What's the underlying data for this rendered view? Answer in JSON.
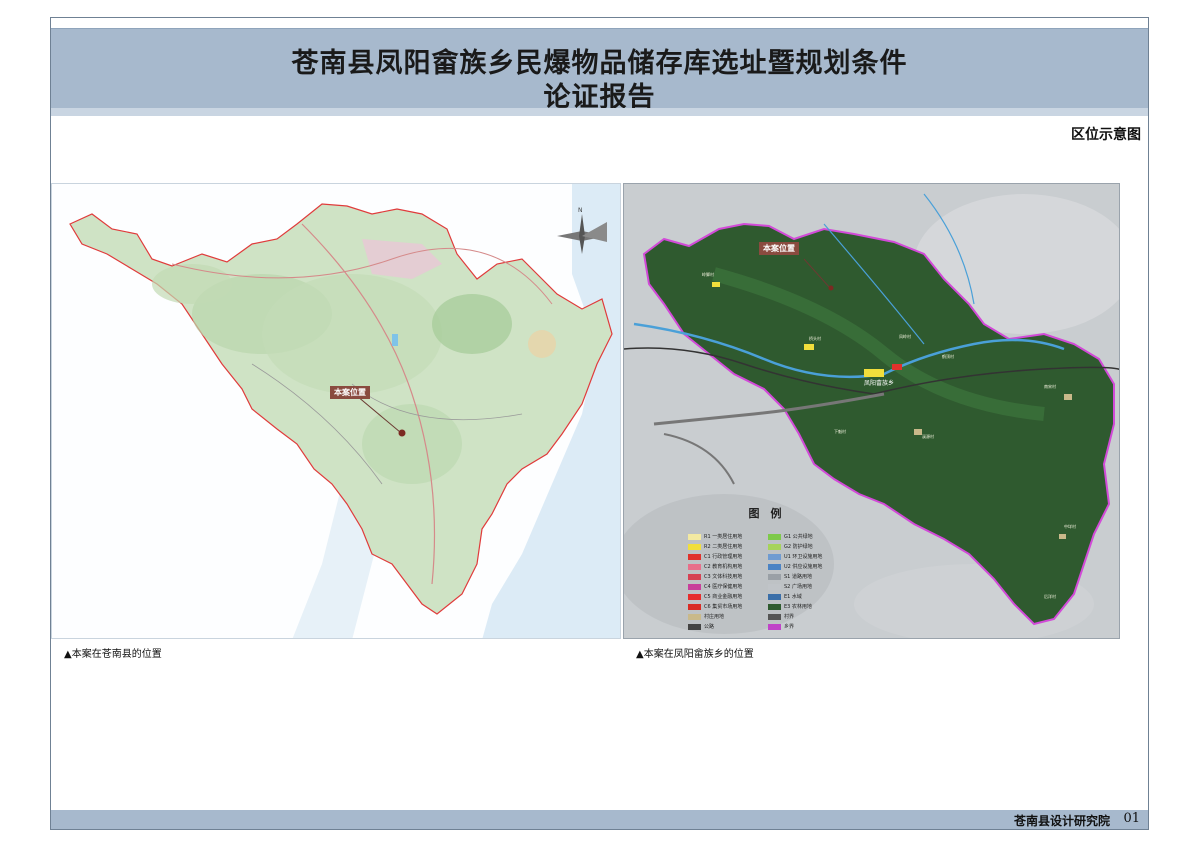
{
  "header": {
    "title_line1": "苍南县凤阳畲族乡民爆物品储存库选址暨规划条件",
    "title_line2": "论证报告"
  },
  "section_label": "区位示意图",
  "left_map": {
    "marker_label": "本案位置",
    "caption": "▲本案在苍南县的位置"
  },
  "right_map": {
    "marker_label": "本案位置",
    "caption": "▲本案在凤阳畲族乡的位置",
    "town_label": "凤阳畲族乡",
    "legend": {
      "title": "图　例",
      "items_left": [
        {
          "code": "R1",
          "label": "一类居住用地",
          "color": "#f3e9a2"
        },
        {
          "code": "R2",
          "label": "二类居住用地",
          "color": "#f1de3c"
        },
        {
          "code": "C1",
          "label": "行政管理用地",
          "color": "#e0312c"
        },
        {
          "code": "C2",
          "label": "教育机构用地",
          "color": "#e86e8a"
        },
        {
          "code": "C3",
          "label": "文体科技用地",
          "color": "#d64153"
        },
        {
          "code": "C4",
          "label": "医疗保健用地",
          "color": "#c83f9a"
        },
        {
          "code": "C5",
          "label": "商业金融用地",
          "color": "#e62d2d"
        },
        {
          "code": "C6",
          "label": "集贸市场用地",
          "color": "#d92b25"
        },
        {
          "code": "",
          "label": "村庄用地",
          "color": "#c9b98a"
        },
        {
          "code": "",
          "label": "公路",
          "color": "#444444"
        }
      ],
      "items_right": [
        {
          "code": "G1",
          "label": "公共绿地",
          "color": "#7ec94a"
        },
        {
          "code": "G2",
          "label": "防护绿地",
          "color": "#a6d35a"
        },
        {
          "code": "U1",
          "label": "环卫设施用地",
          "color": "#6f9bd1"
        },
        {
          "code": "U2",
          "label": "供应设施用地",
          "color": "#4b83c4"
        },
        {
          "code": "S1",
          "label": "道路用地",
          "color": "#9aa0a6"
        },
        {
          "code": "S2",
          "label": "广场用地",
          "color": "#c0c4c8"
        },
        {
          "code": "E1",
          "label": "水域",
          "color": "#3a6ea8"
        },
        {
          "code": "E3",
          "label": "农林用地",
          "color": "#2f5b2f"
        },
        {
          "code": "",
          "label": "村界",
          "color": "#555555"
        },
        {
          "code": "",
          "label": "乡界",
          "color": "#c043c8"
        }
      ]
    },
    "places": [
      "凤阳畲族乡",
      "岭脚村",
      "凤岭村",
      "鹤顶村",
      "桥头村",
      "溪源村",
      "南宋村",
      "中垟村",
      "下魁村",
      "后洋村"
    ]
  },
  "footer": {
    "org": "苍南县设计研究院",
    "page": "01"
  }
}
